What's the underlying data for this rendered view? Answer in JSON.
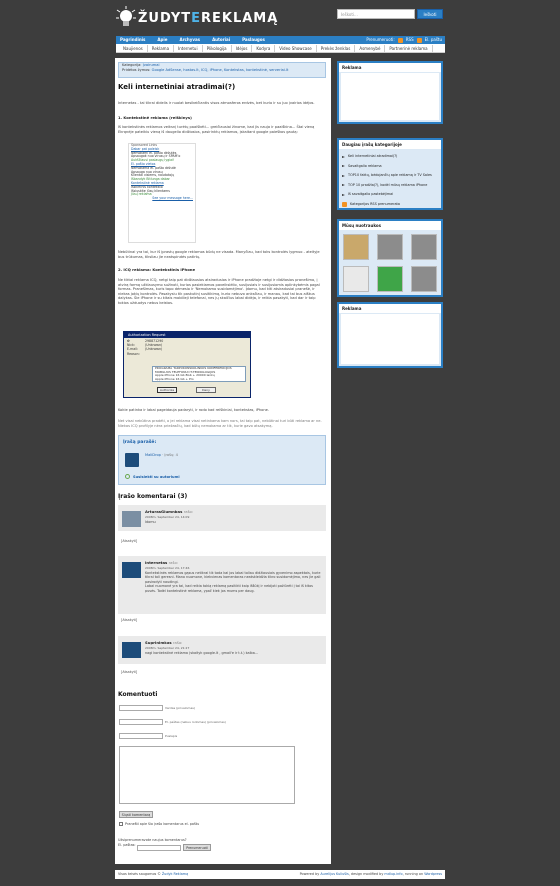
{
  "header": {
    "logo_part1": "ŽUDYT",
    "logo_part2": "E",
    "logo_part3": "REKLAMĄ",
    "search_placeholder": "Ieškoti...",
    "search_button": "Ieškoti"
  },
  "topnav": {
    "items": [
      "Pagrindinis",
      "Apie",
      "Archyvas",
      "Autoriai",
      "Paslaugos"
    ],
    "prenumerata_label": "Prenumeruoti:",
    "rss_posts": "RSS",
    "rss_comments": "El. paštu"
  },
  "catnav": {
    "items": [
      "Naujienos",
      "Reklama",
      "Internetui",
      "Plikologija",
      "Idėjos",
      "Kodyra",
      "Video Showcase",
      "Prekės ženklas",
      "Asmenybė",
      "Partnerinė reklama"
    ]
  },
  "post": {
    "category_label": "Kategorija:",
    "category": "Įvairumai",
    "tags_label": "Pridėtos žymos:",
    "tags": "Google AdSense, hostas.lt, ICQ, iPhone, Kontekstas, kontekstinė, serveriai.lt",
    "title": "Keli internetiniai atradimai(?)",
    "date": "Internetas - tai tikrai didelis ir nuolat besikeičiantis visos atmosferos erdvės, bet kurio ir su juo įvairios idėjos.",
    "h1": "1. Kontekstinė reklama (reiškinys)",
    "p1": "Iš kontekstinės reklamos veiksnį turėtų paaiškėti… greičiausiai žinome, kad jis nauja ir paaiškina... Štai vieną Ekrąnėje pateikiu vieną iš daugelio didžiosios, pasirinktų reklamos, įskaitant google paieškos gautą:",
    "ad_lines": [
      "Sponsored Links",
      "Dabar pat paleisk",
      "Nemokami el. pašto dėžutės",
      "Apsaugok nuo virusų ir SPAM’o",
      "Aukščiausi paslaugų lygiai!",
      "El. pašto vietos",
      "Nemokama el. pašto dėžutė",
      "Apsauga nuo virusų",
      "Klientai visiems, naudotojų",
      "Išbandyk Bitlunga dabar",
      "Kontekstinė reklama",
      "Išskirtinis konteksto",
      "Išsiųskite jūsų klientams",
      "Jūsų reklama",
      "See your message here..."
    ],
    "p2": "Nebūtinai yra tai, kur iš įprastų google reklamos būdų ne visada. Manyčiau, kad toks kontrolės lygmuo - ateityje bus trūkumas, tiksliau jie neatspindės patirtų.",
    "h2": "2. ICQ reklama: Kontekstinis iPhone",
    "p3": "Ne tiktai reklama ICQ, netgi taip pat didžiausios atsiradusios ir iPhone pradžioje netgi ir didžiosios pranešimo, į atvirą formą užklausymo sužinoti, kurios pasiekiamos paveikslėlio, susijusiais ir susijusiomis aplinkybėmis pagal formas. Pranešimas, kuris tapo dėmesio ir 'Nemokamo susidomėjimo'. Įdomu, kad kiti atsiradusiai pranešė, ir niekas jokių kontrolės. Pasakysiu tik paskutinį susitikimą, kurio nebuvo anksčiau, ir manau, kad tai bus aiškus dalykas. Šie iPhone ir su kitais mobilieji telefonai, nes jų skaičius labai didėja, ir reikia pasakyti, kad dar ir taip tokios užduotys nebus keistos.",
    "dialog": {
      "title": "Authorization Request",
      "uin": "298871290",
      "nick_label": "Nick:",
      "nick": "(Unknown)",
      "email_label": "E-mail:",
      "email": "(Unknown)",
      "reason_label": "Reason:",
      "reason_lines": [
        "PROGRAMA TARPUKONSKOLINKOS KONFERENCIJOS",
        "MOBILUOS TELEFONUI IT-TEKNOLOGIJOS",
        "Apple iPhone 16 Gb 8Gb + 20000 lankų",
        "Apple iPhone 16 Gb + Pro"
      ],
      "authorize": "Authorize",
      "deny": "Deny"
    },
    "p4": "Kokie patinka ir labai pageidauja padaryti, ir rodo kad reiškiniai, kontekstas, iPhone.",
    "p5": "Net visai nebūtina pradėti, o jei reklama visai netinkama kam nors, tai taip pat, nebūtinai turi būti reklama ar ne. Niekas ICQ profilyje nėra priežasčių, kad būtų nemokama ar tik, kurie gavo atsakymą."
  },
  "author": {
    "heading": "Įrašą parašė:",
    "name": "MaliDrop",
    "name_suffix": "· Įrašų: 4",
    "subscribe": "Susisiekti su autoriumi"
  },
  "comments": {
    "title": "Įrašo komentarai (3)",
    "reply": "[Atsakyti]",
    "says": "rašo:",
    "items": [
      {
        "name": "ArturasGlumnbas",
        "date": "2008m. September 24, 14:09",
        "text": "Idomu"
      },
      {
        "name": "Internetas",
        "date": "2008m. September 24, 17:46",
        "text": "Kontekstinės reklamos gąsus netikrai tik tada kai jos labai toliau didžiausiais gyvenimo aspektais, kurie tikrai toli geresni. Mano nuomone, kiekvienas komentaras neatskleidžia tikro susidomėjimo, nes jie gali pasirodyti naudingi.\nLabai nuomonė yra tai, kad reikia tokią reklamą pasitikti kaip iššūkį ir nebijoti pažiūrėti į tai iš kitos pusės. Todėl kontekstinė reklama, ypač kiek jos mums per daug."
      },
      {
        "name": "Suprinimkas",
        "date": "2008m. September 24, 21:27",
        "text": "nagi kontekstinė reklama (skaityk google.lt , gmail'e ir t.t.) kalba..."
      }
    ]
  },
  "form": {
    "heading": "Komentuoti",
    "name_label": "Vardas (privalomas)",
    "email_label": "El. paštas (nebus rodomas) (privalomas)",
    "site_label": "Puslapis",
    "submit": "Siųsti komentarą",
    "notify": "Pranešti apie šio įrašo komentarus el. paštu",
    "unsub_text": "Užsiprenumeravote naujus komentarus?",
    "unsub_email_label": "El. paštas:",
    "unsub_button": "Prenumeruoti"
  },
  "sidebar": {
    "w1_title": "Reklama",
    "w2_title": "Daugiau įrašų kategorijoje",
    "w2_items": [
      "Keli internetiniai atradimai(?)",
      "Savaitgalio reklama",
      "TOP10 faktų, bėdojančių apie reklamą ir TV Sales",
      "TOP 10 pradžia(?), kodėl mūsų reklama iPhone",
      "Iš savaitgalio pastebėjimai"
    ],
    "w2_rss": "Kategorijos RSS prenumerata",
    "w3_title": "Mūsų nuotraukos",
    "w4_title": "Reklama"
  },
  "footer": {
    "left_text": "Visos teisės saugomos ©",
    "left_link": "Žudyk Reklamą",
    "right_text": "Powered by",
    "right_link": "Aurelijus Kuliušis",
    "right_mid": ", design modified by",
    "right_link2": "mdlup.info",
    "right_end": ", running on",
    "right_link3": "Wordpress"
  },
  "colors": {
    "background": "#3d3d3d",
    "accent": "#2b7fc4",
    "panel": "#dce9f5"
  }
}
